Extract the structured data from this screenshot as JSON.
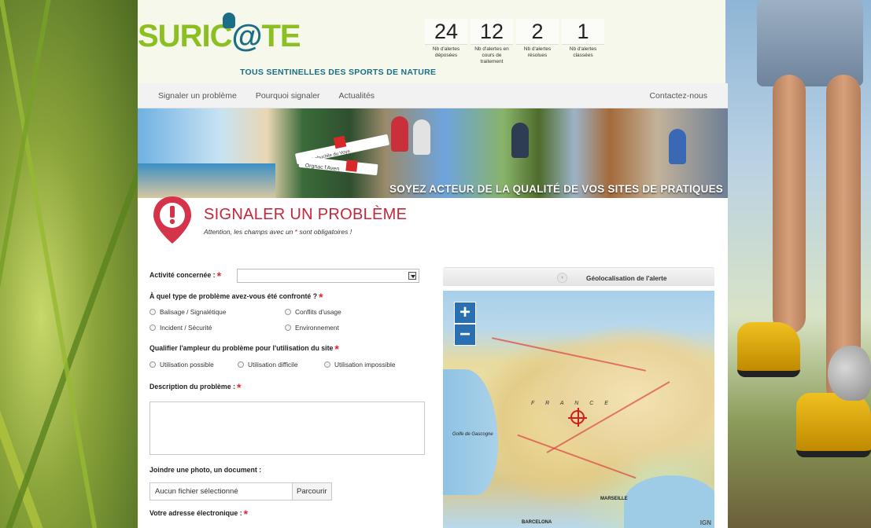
{
  "brand": {
    "logo_text_left": "SURIC",
    "logo_at": "@",
    "logo_text_right": "TE",
    "tagline": "TOUS SENTINELLES DES SPORTS DE NATURE"
  },
  "counters": [
    {
      "value": "24",
      "label": "Nb d'alertes déposées"
    },
    {
      "value": "12",
      "label": "Nb d'alertes en cours de traitement"
    },
    {
      "value": "2",
      "label": "Nb d'alertes résolues"
    },
    {
      "value": "1",
      "label": "Nb d'alertes classées"
    }
  ],
  "nav": {
    "items": [
      "Signaler un problème",
      "Pourquoi signaler",
      "Actualités"
    ],
    "contact": "Contactez-nous"
  },
  "banner": {
    "caption": "SOYEZ ACTEUR DE LA QUALITÉ DE VOS SITES DE PRATIQUES",
    "sign_top": "Lebuchile du Voye",
    "sign_bottom": "Orgnac l'Aven"
  },
  "form": {
    "title": "SIGNALER UN PROBLÈME",
    "note_before": "Attention, les champs avec un",
    "note_star": "*",
    "note_after": "sont obligatoires !",
    "activity_label": "Activité concernée :",
    "activity_value": "",
    "problem_type_label": "À quel type de problème avez-vous été confronté ?",
    "problem_types": [
      "Balisage / Signalétique",
      "Conflits d'usage",
      "Incident / Sécurité",
      "Environnement"
    ],
    "severity_label": "Qualifier l'ampleur du problème pour l'utilisation du site",
    "severities": [
      "Utilisation possible",
      "Utilisation difficile",
      "Utilisation impossible"
    ],
    "description_label": "Description du problème :",
    "attach_label": "Joindre une photo, un document :",
    "file_placeholder": "Aucun fichier sélectionné",
    "browse_button": "Parcourir",
    "email_label": "Votre adresse électronique :"
  },
  "map": {
    "tab_label": "Géolocalisation de l'alerte",
    "tab_icon": "chevron-right-icon",
    "zoom_in": "+",
    "zoom_out": "−",
    "country_label": "F R A N C E",
    "gulf_label": "Golfe de Gascogne",
    "city_marseille": "MARSEILLE",
    "city_barcelona": "BARCELONA",
    "attribution": "IGN"
  },
  "colors": {
    "accent_red": "#c4263c",
    "logo_green": "#8bbf22",
    "logo_teal": "#1b6e86",
    "zoom_blue": "#2b6fb3"
  }
}
